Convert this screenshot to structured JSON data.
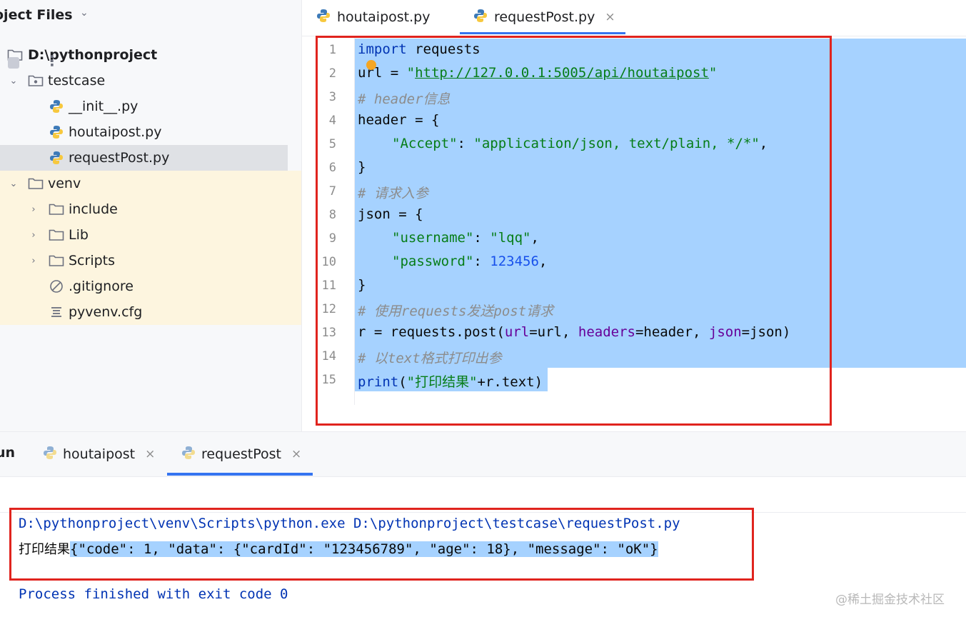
{
  "project": {
    "title": "oject Files",
    "tree": [
      {
        "label": "D:\\pythonproject",
        "kind": "folder-root"
      },
      {
        "label": "testcase",
        "kind": "folder-package",
        "expanded": true
      },
      {
        "label": "__init__.py",
        "kind": "python-file"
      },
      {
        "label": "houtaipost.py",
        "kind": "python-file"
      },
      {
        "label": "requestPost.py",
        "kind": "python-file",
        "selected": true
      },
      {
        "label": "venv",
        "kind": "folder",
        "expanded": true
      },
      {
        "label": "include",
        "kind": "folder",
        "expanded": false
      },
      {
        "label": "Lib",
        "kind": "folder",
        "expanded": false
      },
      {
        "label": "Scripts",
        "kind": "folder",
        "expanded": false
      },
      {
        "label": ".gitignore",
        "kind": "ignore-file"
      },
      {
        "label": "pyvenv.cfg",
        "kind": "config-file"
      }
    ]
  },
  "editor": {
    "tabs": [
      {
        "label": "houtaipost.py",
        "active": false
      },
      {
        "label": "requestPost.py",
        "active": true,
        "close": "×"
      }
    ],
    "line_numbers": [
      "1",
      "2",
      "3",
      "4",
      "5",
      "6",
      "7",
      "8",
      "9",
      "10",
      "11",
      "12",
      "13",
      "14",
      "15"
    ],
    "code": {
      "l1_kw": "import",
      "l1_rest": " requests",
      "l2_a": "url = ",
      "l2_q1": "\"",
      "l2_url": "http://127.0.0.1:5005/api/houtaipost",
      "l2_q2": "\"",
      "l3": "# header信息",
      "l4": "header = {",
      "l5_key": "\"Accept\"",
      "l5_colon": ": ",
      "l5_val": "\"application/json, text/plain, */*\"",
      "l5_end": ",",
      "l6": "}",
      "l7": "# 请求入参",
      "l8": "json = {",
      "l9_key": "\"username\"",
      "l9_colon": ": ",
      "l9_val": "\"lqq\"",
      "l9_end": ",",
      "l10_key": "\"password\"",
      "l10_colon": ": ",
      "l10_val": "123456",
      "l10_end": ",",
      "l11": "}",
      "l12": "# 使用requests发送post请求",
      "l13_a": "r = requests.post(",
      "l13_p1": "url",
      "l13_b": "=url, ",
      "l13_p2": "headers",
      "l13_c": "=header, ",
      "l13_p3": "json",
      "l13_d": "=json)",
      "l14": "# 以text格式打印出参",
      "l15_kw": "print",
      "l15_a": "(",
      "l15_str": "\"打印结果\"",
      "l15_b": "+r.text)"
    }
  },
  "run": {
    "label": "un",
    "tabs": [
      {
        "label": "houtaipost",
        "active": false,
        "close": "×"
      },
      {
        "label": "requestPost",
        "active": true,
        "close": "×"
      }
    ],
    "more": "⋮",
    "console": {
      "command": "D:\\pythonproject\\venv\\Scripts\\python.exe D:\\pythonproject\\testcase\\requestPost.py",
      "output_prefix": "打印结果",
      "output_json": "{\"code\": 1, \"data\": {\"cardId\": \"123456789\", \"age\": 18}, \"message\": \"oK\"}",
      "exit": "Process finished with exit code 0"
    }
  },
  "watermark": "@稀土掘金技术社区",
  "colors": {
    "accent": "#3574f0",
    "selection": "#a6d2ff",
    "annotation_red": "#e0241e",
    "venv_highlight": "#fdf5df"
  }
}
